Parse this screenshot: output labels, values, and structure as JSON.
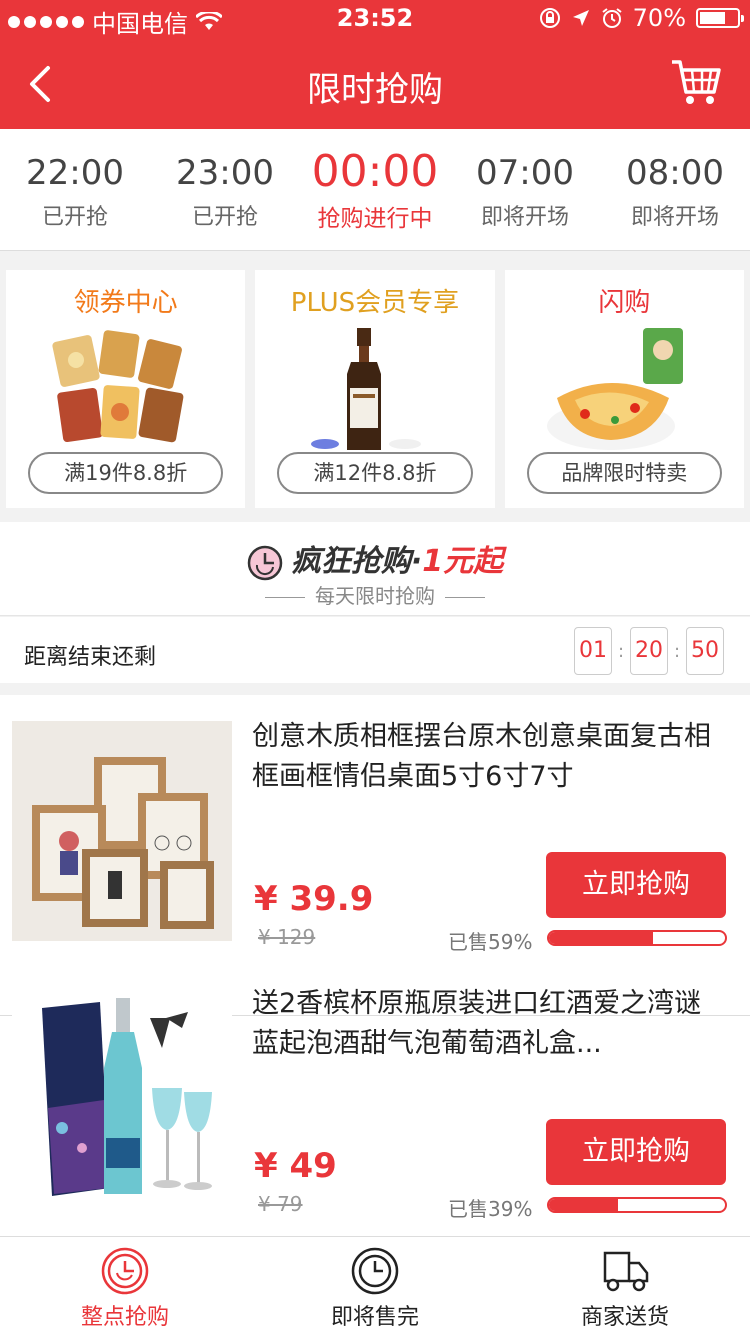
{
  "status_bar": {
    "carrier": "中国电信",
    "time": "23:52",
    "battery": "70%",
    "battery_level": 0.7
  },
  "header": {
    "title": "限时抢购"
  },
  "time_tabs": [
    {
      "time": "22:00",
      "status": "已开抢"
    },
    {
      "time": "23:00",
      "status": "已开抢"
    },
    {
      "time": "00:00",
      "status": "抢购进行中",
      "active": true
    },
    {
      "time": "07:00",
      "status": "即将开场"
    },
    {
      "time": "08:00",
      "status": "即将开场"
    }
  ],
  "promo_cards": [
    {
      "title": "领券中心",
      "title_color": "#f27a1a",
      "button": "满19件8.8折"
    },
    {
      "title": "PLUS会员专享",
      "title_color": "#e0a020",
      "button": "满12件8.8折"
    },
    {
      "title": "闪购",
      "title_color": "#e9363a",
      "button": "品牌限时特卖"
    }
  ],
  "banner": {
    "headline": "疯狂抢购",
    "dot": "·",
    "highlight": "1元起",
    "subtitle": "每天限时抢购"
  },
  "countdown": {
    "label": "距离结束还剩",
    "hours": "01",
    "minutes": "20",
    "seconds": "50"
  },
  "products": [
    {
      "name": "创意木质相框摆台原木创意桌面复古相框画框情侣桌面5寸6寸7寸",
      "price": "¥ 39.9",
      "original_price": "¥ 129",
      "sold": "已售59%",
      "sold_fraction": 0.59,
      "button": "立即抢购"
    },
    {
      "name": "送2香槟杯原瓶原装进口红酒爱之湾谜蓝起泡酒甜气泡葡萄酒礼盒...",
      "price": "¥ 49",
      "original_price": "¥ 79",
      "sold": "已售39%",
      "sold_fraction": 0.39,
      "button": "立即抢购"
    }
  ],
  "bottom_nav": [
    {
      "label": "整点抢购",
      "active": true
    },
    {
      "label": "即将售完"
    },
    {
      "label": "商家送货"
    }
  ],
  "colors": {
    "brand_red": "#e9363a"
  }
}
